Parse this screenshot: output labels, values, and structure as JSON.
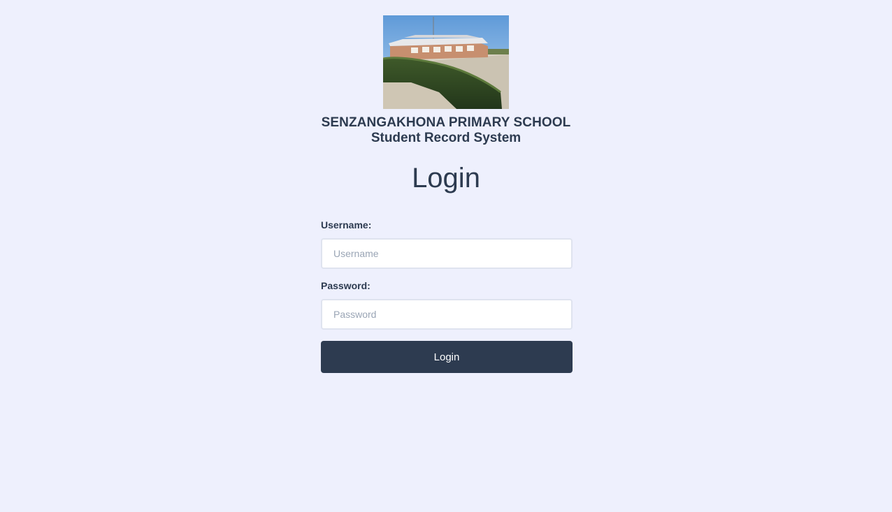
{
  "header": {
    "school_name": "SENZANGAKHONA PRIMARY SCHOOL",
    "system_name": "Student Record System",
    "photo_alt": "school-building-photo"
  },
  "login": {
    "title": "Login",
    "username_label": "Username:",
    "username_placeholder": "Username",
    "username_value": "",
    "password_label": "Password:",
    "password_placeholder": "Password",
    "password_value": "",
    "submit_label": "Login"
  },
  "colors": {
    "background": "#eef0fd",
    "primary": "#2d3b50",
    "input_border": "#dfe3ef",
    "placeholder": "#9aa5b5"
  }
}
